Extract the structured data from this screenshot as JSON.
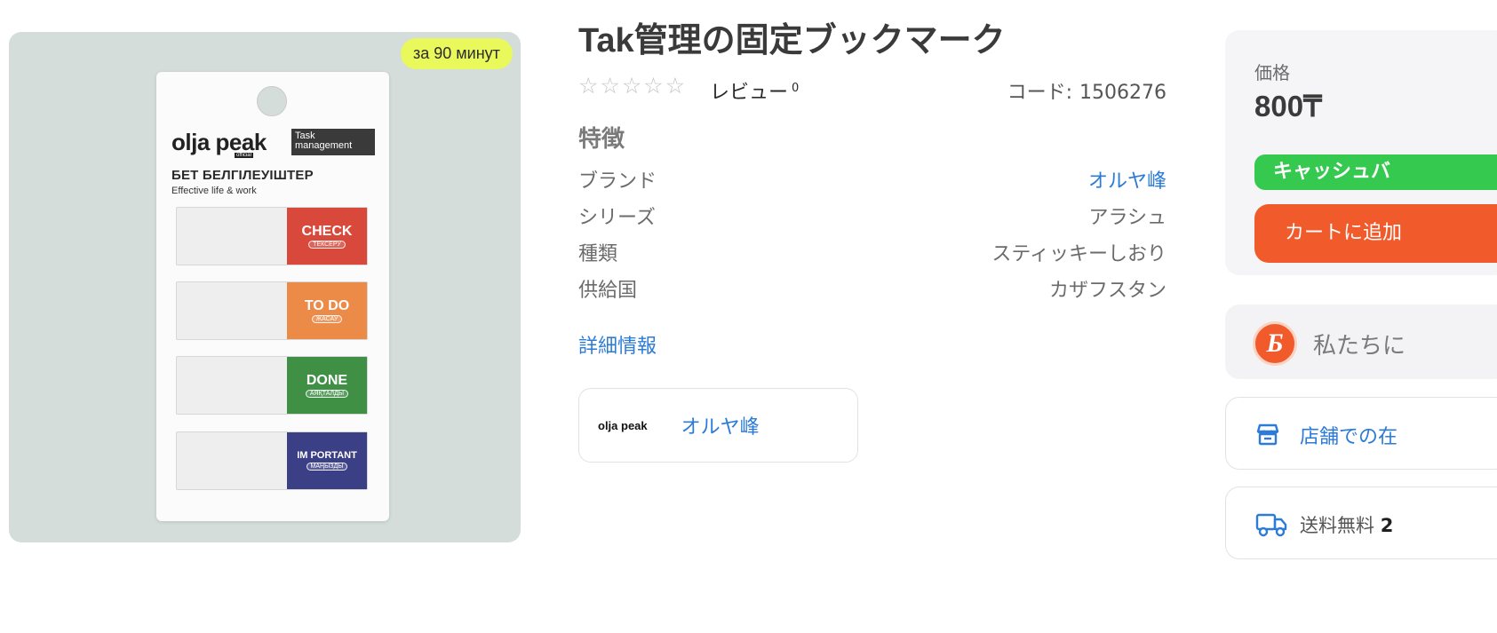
{
  "gallery": {
    "badge": "за 90 минут",
    "package": {
      "brand": "olja peak",
      "brand_sub": "official",
      "box_line1": "Task",
      "box_line2": "management",
      "title": "БЕТ БЕЛГІЛЕУІШТЕР",
      "subtitle": "Effective life & work",
      "tabs": [
        {
          "main": "CHECK",
          "small": "ТЕКСЕРУ",
          "color": "#d9493b"
        },
        {
          "main": "TO DO",
          "small": "ЖАСАУ",
          "color": "#ec8a48"
        },
        {
          "main": "DONE",
          "small": "АЯҚТАЛДЫ",
          "color": "#3f8f45"
        },
        {
          "main": "IM PORTANT",
          "small": "МАҢЫЗДЫ",
          "color": "#3b3f86"
        }
      ]
    }
  },
  "product": {
    "title": "Tak管理の固定ブックマーク",
    "stars": [
      "☆",
      "☆",
      "☆",
      "☆",
      "☆"
    ],
    "review_label": "レビュー",
    "review_count": "0",
    "code_label": "コード:",
    "code_value": "1506276",
    "section_title": "特徴",
    "specs": [
      {
        "label": "ブランド",
        "value": "オルヤ峰"
      },
      {
        "label": "シリーズ",
        "value": "アラシュ"
      },
      {
        "label": "種類",
        "value": "スティッキーしおり"
      },
      {
        "label": "供給国",
        "value": "カザフスタン"
      }
    ],
    "more_link": "詳細情報",
    "brand_card": {
      "logo": "olja peak",
      "name": "オルヤ峰"
    }
  },
  "buy": {
    "price_label": "価格",
    "price": "800₸",
    "cashback": "キャッシュバ",
    "add_to_cart": "カートに追加",
    "promo_icon": "Б",
    "promo_text": "私たちに",
    "store_text": "店舗での在",
    "shipping_text": "送料無料",
    "shipping_bold": "2"
  },
  "colors": {
    "accent": "#f15a2b",
    "link": "#2c7bd6",
    "cashback": "#36c950",
    "badge": "#e9f85a"
  }
}
